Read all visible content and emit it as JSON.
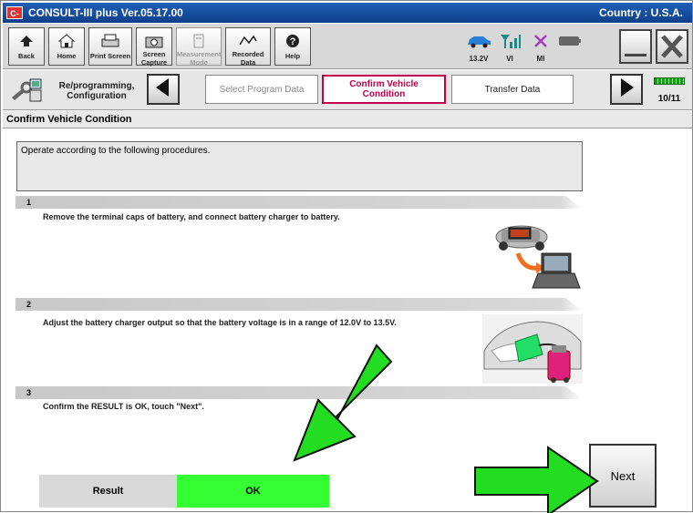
{
  "window": {
    "logo": "C-III",
    "title": "CONSULT-III plus  Ver.05.17.00",
    "country": "Country : U.S.A."
  },
  "toolbar": {
    "back": "Back",
    "home": "Home",
    "print_screen": "Print Screen",
    "screen_capture": "Screen\nCapture",
    "measurement_mode": "Measurement\nMode",
    "recorded_data": "Recorded\nData",
    "help": "Help",
    "voltage": "13.2V",
    "vi": "VI",
    "mi": "MI"
  },
  "navbar": {
    "config_label": "Re/programming,\nConfiguration",
    "steps": [
      {
        "label": "Select Program Data",
        "state": "past"
      },
      {
        "label": "Confirm Vehicle\nCondition",
        "state": "current"
      },
      {
        "label": "Transfer Data",
        "state": "next"
      }
    ],
    "page_indicator": "10/11"
  },
  "header": {
    "title": "Confirm Vehicle Condition"
  },
  "message": "Operate according to the following procedures.",
  "procedure_steps": [
    {
      "number": "1",
      "text": "Remove the terminal caps of battery, and connect battery charger to battery."
    },
    {
      "number": "2",
      "text": "Adjust the battery charger output so that the battery voltage is in a range of 12.0V to 13.5V."
    },
    {
      "number": "3",
      "text": "Confirm the RESULT is OK, touch \"Next\"."
    }
  ],
  "result": {
    "label": "Result",
    "value": "OK"
  },
  "next_button": "Next",
  "colors": {
    "title_bar": "#1f5fb6",
    "current_step": "#c0004a",
    "ok_green": "#33ff33",
    "arrow_green": "#22dd22"
  }
}
